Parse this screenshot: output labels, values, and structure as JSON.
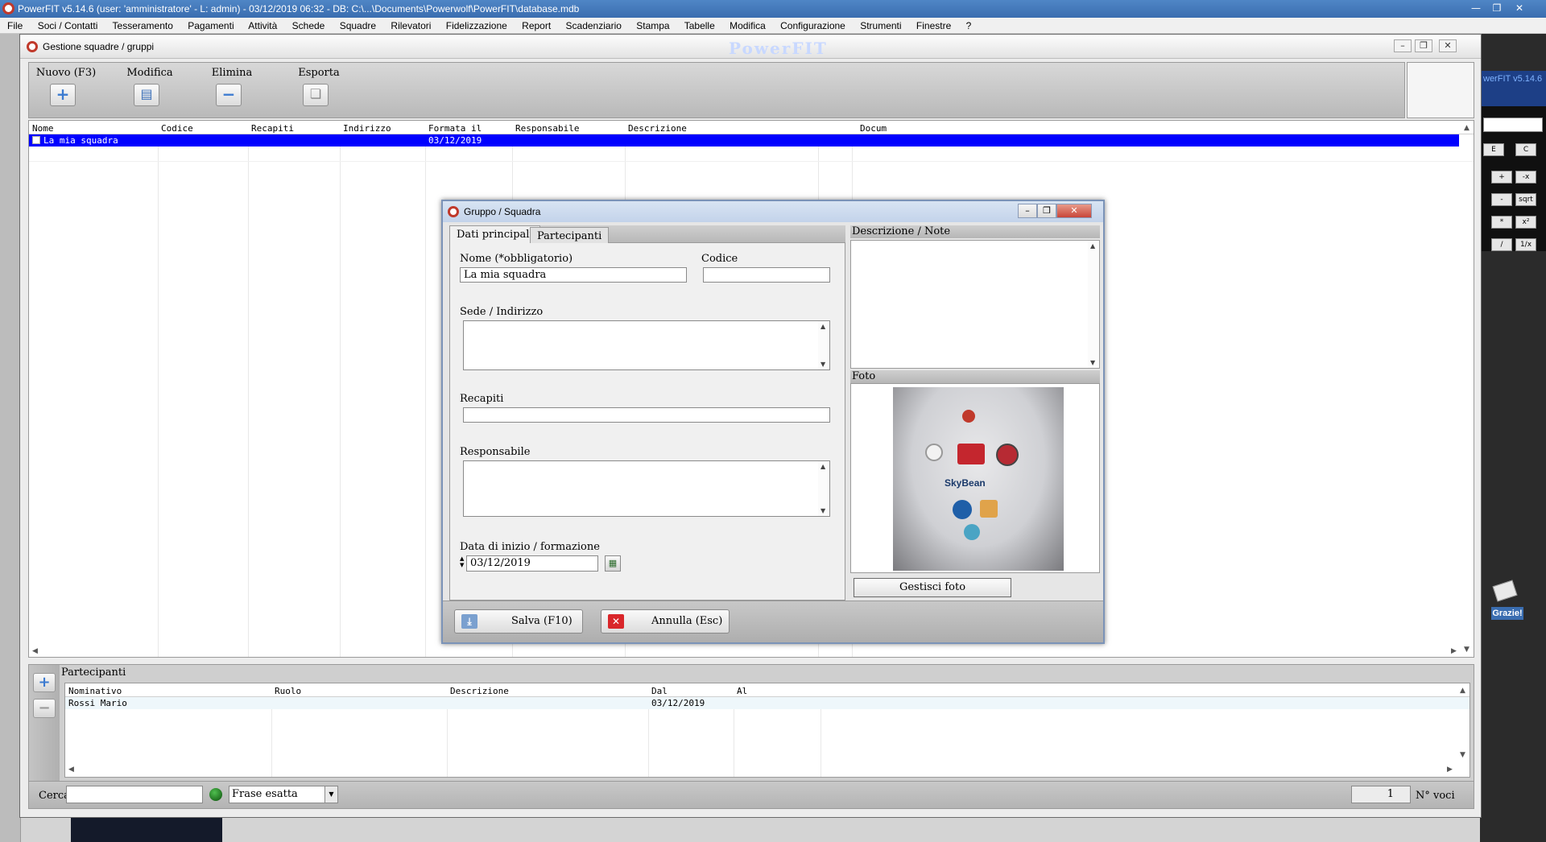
{
  "app": {
    "title": "PowerFIT v5.14.6  (user: 'amministratore'  - L: admin) - 03/12/2019 06:32 - DB: C:\\...\\Documents\\Powerwolf\\PowerFIT\\database.mdb",
    "brand": "PowerFIT",
    "side_version": "werFIT v5.14.6",
    "thanks": "Grazie!"
  },
  "menu": [
    "File",
    "Soci / Contatti",
    "Tesseramento",
    "Pagamenti",
    "Attività",
    "Schede",
    "Squadre",
    "Rilevatori",
    "Fidelizzazione",
    "Report",
    "Scadenziario",
    "Stampa",
    "Tabelle",
    "Modifica",
    "Configurazione",
    "Strumenti",
    "Finestre",
    "?"
  ],
  "calculator": [
    "E",
    "C",
    "+",
    "-x",
    "-",
    "sqrt",
    "*",
    "x²",
    "/",
    "1/x"
  ],
  "main_window": {
    "title": "Gestione squadre / gruppi",
    "toolbar": {
      "new_label": "Nuovo (F3)",
      "edit_label": "Modifica",
      "delete_label": "Elimina",
      "export_label": "Esporta"
    },
    "grid": {
      "columns": [
        "Nome",
        "Codice",
        "Recapiti",
        "Indirizzo",
        "Formata il",
        "Responsabile",
        "Descrizione",
        "Docum"
      ],
      "rows": [
        {
          "nome": "La mia squadra",
          "formata_il": "03/12/2019"
        }
      ]
    },
    "participants": {
      "label": "Partecipanti",
      "columns": [
        "Nominativo",
        "Ruolo",
        "Descrizione",
        "Dal",
        "Al"
      ],
      "rows": [
        {
          "nominativo": "Rossi Mario",
          "dal": "03/12/2019"
        }
      ]
    },
    "search": {
      "label": "Cerca:",
      "value": "",
      "mode": "Frase esatta",
      "count": "1",
      "count_label": "N° voci"
    }
  },
  "dialog": {
    "title": "Gruppo / Squadra",
    "tabs": [
      "Dati principali",
      "Partecipanti"
    ],
    "fields": {
      "name_label": "Nome (*obbligatorio)",
      "name_value": "La mia squadra",
      "code_label": "Codice",
      "code_value": "",
      "address_label": "Sede / Indirizzo",
      "contacts_label": "Recapiti",
      "manager_label": "Responsabile",
      "date_label": "Data di inizio / formazione",
      "date_value": "03/12/2019"
    },
    "notes_label": "Descrizione / Note",
    "photo_label": "Foto",
    "photo_button": "Gestisci foto",
    "photo_text": "SkyBean",
    "save_button": "Salva (F10)",
    "cancel_button": "Annulla (Esc)"
  },
  "colors": {
    "selection": "#0000ff",
    "titlebar": "#3a6db0",
    "accent_red": "#c0392b"
  }
}
